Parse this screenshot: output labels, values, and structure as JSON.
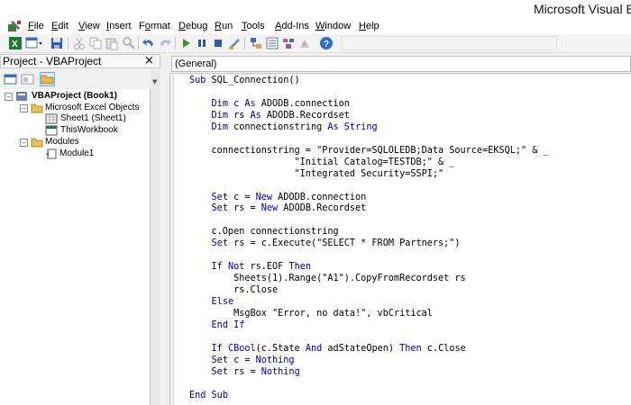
{
  "window": {
    "title": "Microsoft Visual Basic"
  },
  "menu": {
    "items": [
      {
        "label": "File",
        "mnemonic": "F"
      },
      {
        "label": "Edit",
        "mnemonic": "E"
      },
      {
        "label": "View",
        "mnemonic": "V"
      },
      {
        "label": "Insert",
        "mnemonic": "I"
      },
      {
        "label": "Format",
        "mnemonic": "o"
      },
      {
        "label": "Debug",
        "mnemonic": "D"
      },
      {
        "label": "Run",
        "mnemonic": "R"
      },
      {
        "label": "Tools",
        "mnemonic": "T"
      },
      {
        "label": "Add-Ins",
        "mnemonic": "A"
      },
      {
        "label": "Window",
        "mnemonic": "W"
      },
      {
        "label": "Help",
        "mnemonic": "H"
      }
    ]
  },
  "toolbar": {
    "icons": [
      "excel-icon",
      "insert-userform-icon",
      "save-icon",
      "cut-icon",
      "copy-icon",
      "paste-icon",
      "find-icon",
      "undo-icon",
      "redo-icon",
      "run-icon",
      "break-icon",
      "reset-icon",
      "design-mode-icon",
      "project-explorer-icon",
      "properties-icon",
      "object-browser-icon",
      "toolbox-icon",
      "help-icon"
    ]
  },
  "project_panel": {
    "title": "Project - VBAProject",
    "close_glyph": "×",
    "toolbar_icons": [
      "view-code-icon",
      "view-object-icon",
      "toggle-folders-icon"
    ],
    "tree": [
      {
        "label": "VBAProject (Book1)",
        "level": 0,
        "expanded": true,
        "bold": true,
        "icon": "vba-project-icon"
      },
      {
        "label": "Microsoft Excel Objects",
        "level": 1,
        "expanded": true,
        "icon": "folder-icon"
      },
      {
        "label": "Sheet1 (Sheet1)",
        "level": 2,
        "icon": "worksheet-icon"
      },
      {
        "label": "ThisWorkbook",
        "level": 2,
        "icon": "workbook-icon"
      },
      {
        "label": "Modules",
        "level": 1,
        "expanded": true,
        "icon": "folder-icon"
      },
      {
        "label": "Module1",
        "level": 2,
        "icon": "module-icon"
      }
    ]
  },
  "code_window": {
    "object_combo": "(General)",
    "lines": [
      "Sub SQL_Connection()",
      "",
      "    Dim c As ADODB.connection",
      "    Dim rs As ADODB.Recordset",
      "    Dim connectionstring As String",
      "",
      "    connectionstring = \"Provider=SQLOLEDB;Data Source=EKSQL;\" & _",
      "                   \"Initial Catalog=TESTDB;\" & _",
      "                   \"Integrated Security=SSPI;\"",
      "",
      "    Set c = New ADODB.connection",
      "    Set rs = New ADODB.Recordset",
      "",
      "    c.Open connectionstring",
      "    Set rs = c.Execute(\"SELECT * FROM Partners;\")",
      "",
      "    If Not rs.EOF Then",
      "        Sheets(1).Range(\"A1\").CopyFromRecordset rs",
      "        rs.Close",
      "    Else",
      "        MsgBox \"Error, no data!\", vbCritical",
      "    End If",
      "",
      "    If CBool(c.State And adStateOpen) Then c.Close",
      "    Set c = Nothing",
      "    Set rs = Nothing",
      "",
      "End Sub"
    ]
  },
  "colors": {
    "keyword": "#00008b",
    "selection": "#dce9f7"
  }
}
